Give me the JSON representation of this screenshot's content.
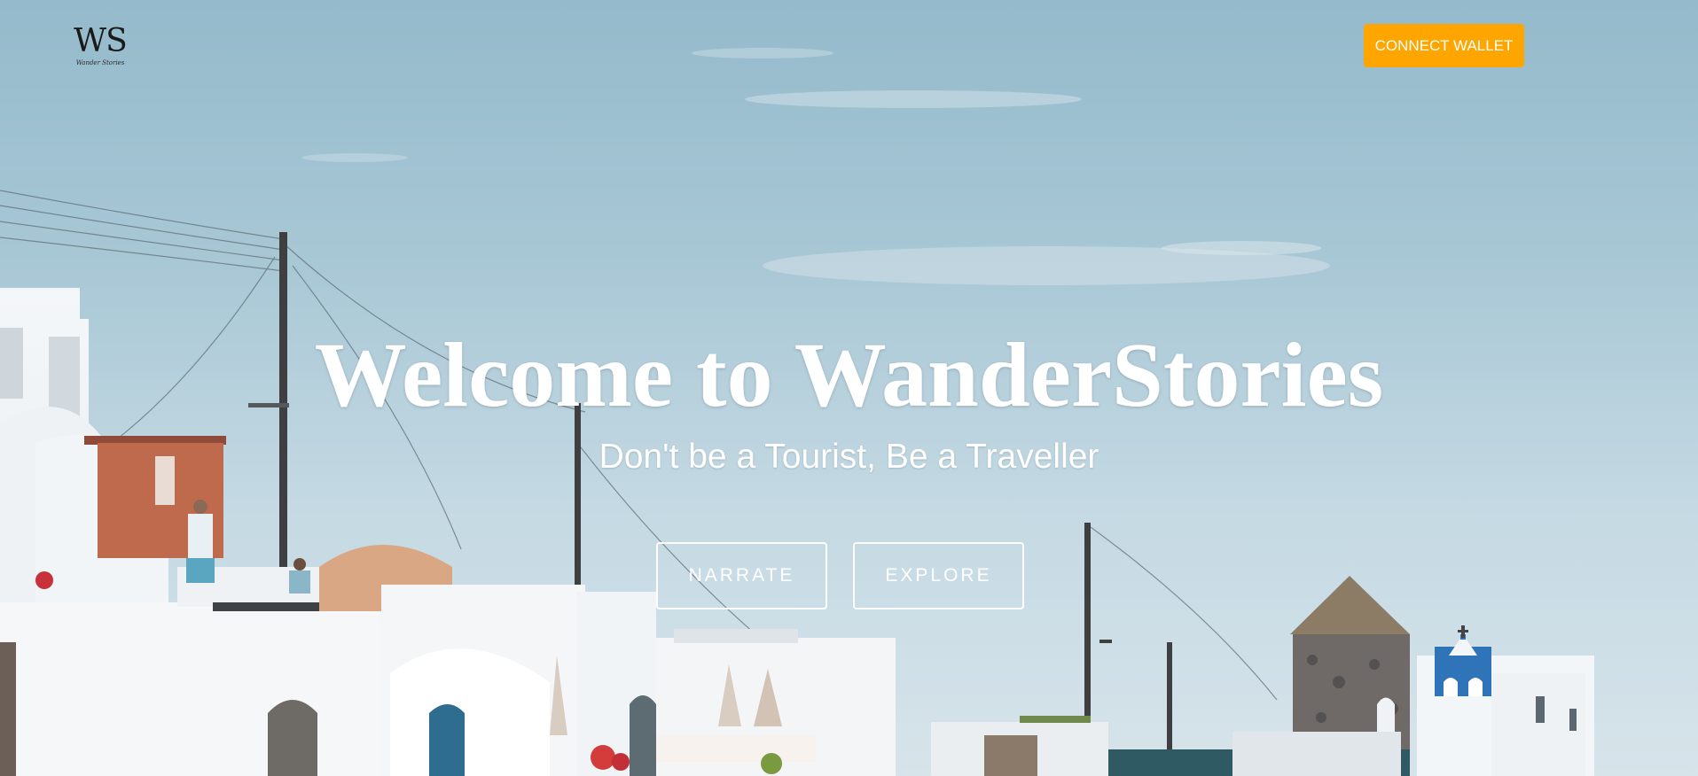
{
  "header": {
    "logo": {
      "mark": "WS",
      "sub": "Wander Stories",
      "icon": "ws-logo"
    },
    "connect_wallet_label": "CONNECT WALLET",
    "connect_wallet_color": "#ffa500"
  },
  "hero": {
    "title": "Welcome to WanderStories",
    "subtitle": "Don't be a Tourist, Be a Traveller",
    "buttons": {
      "narrate_label": "NARRATE",
      "explore_label": "EXPLORE"
    },
    "background_image": "santorini-village-photo"
  },
  "colors": {
    "accent": "#ffa500",
    "text_light": "#ffffff",
    "sky": "#9fc2d1"
  }
}
